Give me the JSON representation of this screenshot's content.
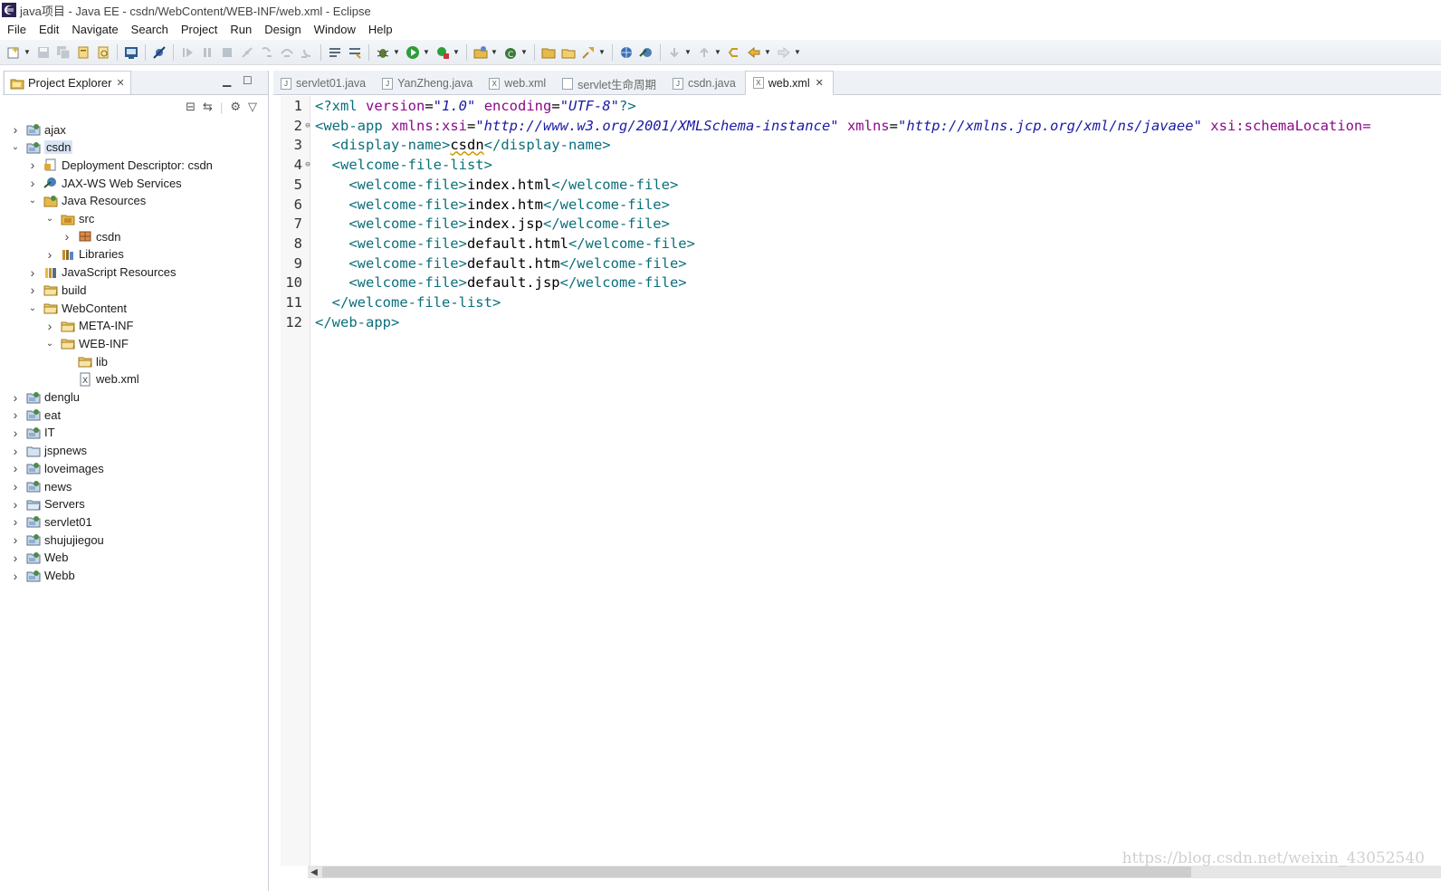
{
  "window": {
    "title": "java项目 - Java EE - csdn/WebContent/WEB-INF/web.xml - Eclipse"
  },
  "menu": [
    "File",
    "Edit",
    "Navigate",
    "Search",
    "Project",
    "Run",
    "Design",
    "Window",
    "Help"
  ],
  "explorer": {
    "tab_label": "Project Explorer",
    "tree": [
      {
        "label": "ajax",
        "depth": 0,
        "expanded": false,
        "icon": "project-icon"
      },
      {
        "label": "csdn",
        "depth": 0,
        "expanded": true,
        "icon": "project-icon",
        "selected": true
      },
      {
        "label": "Deployment Descriptor: csdn",
        "depth": 1,
        "expanded": false,
        "icon": "descriptor-icon"
      },
      {
        "label": "JAX-WS Web Services",
        "depth": 1,
        "expanded": false,
        "icon": "webservice-icon"
      },
      {
        "label": "Java Resources",
        "depth": 1,
        "expanded": true,
        "icon": "java-resources-icon"
      },
      {
        "label": "src",
        "depth": 2,
        "expanded": true,
        "icon": "src-folder-icon"
      },
      {
        "label": "csdn",
        "depth": 3,
        "expanded": false,
        "icon": "package-icon"
      },
      {
        "label": "Libraries",
        "depth": 2,
        "expanded": false,
        "icon": "library-icon"
      },
      {
        "label": "JavaScript Resources",
        "depth": 1,
        "expanded": false,
        "icon": "js-resources-icon"
      },
      {
        "label": "build",
        "depth": 1,
        "expanded": false,
        "icon": "folder-icon"
      },
      {
        "label": "WebContent",
        "depth": 1,
        "expanded": true,
        "icon": "folder-icon"
      },
      {
        "label": "META-INF",
        "depth": 2,
        "expanded": false,
        "icon": "folder-icon"
      },
      {
        "label": "WEB-INF",
        "depth": 2,
        "expanded": true,
        "icon": "folder-icon"
      },
      {
        "label": "lib",
        "depth": 3,
        "leaf": true,
        "icon": "folder-icon"
      },
      {
        "label": "web.xml",
        "depth": 3,
        "leaf": true,
        "icon": "xml-file-icon"
      },
      {
        "label": "denglu",
        "depth": 0,
        "expanded": false,
        "icon": "project-icon"
      },
      {
        "label": "eat",
        "depth": 0,
        "expanded": false,
        "icon": "project-icon"
      },
      {
        "label": "IT",
        "depth": 0,
        "expanded": false,
        "icon": "project-icon"
      },
      {
        "label": "jspnews",
        "depth": 0,
        "expanded": false,
        "icon": "plain-project-icon"
      },
      {
        "label": "loveimages",
        "depth": 0,
        "expanded": false,
        "icon": "project-icon"
      },
      {
        "label": "news",
        "depth": 0,
        "expanded": false,
        "icon": "project-icon"
      },
      {
        "label": "Servers",
        "depth": 0,
        "expanded": false,
        "icon": "servers-folder-icon"
      },
      {
        "label": "servlet01",
        "depth": 0,
        "expanded": false,
        "icon": "project-icon"
      },
      {
        "label": "shujujiegou",
        "depth": 0,
        "expanded": false,
        "icon": "project-icon"
      },
      {
        "label": "Web",
        "depth": 0,
        "expanded": false,
        "icon": "project-icon"
      },
      {
        "label": "Webb",
        "depth": 0,
        "expanded": false,
        "icon": "project-icon"
      }
    ]
  },
  "editor": {
    "tabs": [
      {
        "label": "servlet01.java",
        "icon": "J",
        "active": false
      },
      {
        "label": "YanZheng.java",
        "icon": "J",
        "active": false
      },
      {
        "label": "web.xml",
        "icon": "X",
        "active": false
      },
      {
        "label": "servlet生命周期",
        "icon": "",
        "active": false
      },
      {
        "label": "csdn.java",
        "icon": "J",
        "active": false
      },
      {
        "label": "web.xml",
        "icon": "X",
        "active": true
      }
    ],
    "lines": [
      {
        "n": "1",
        "fold": "",
        "tokens": [
          [
            "pi",
            "<?xml "
          ],
          [
            "attr",
            "version"
          ],
          [
            "txt",
            "="
          ],
          [
            "str",
            "\"1.0\""
          ],
          [
            "txt",
            " "
          ],
          [
            "attr",
            "encoding"
          ],
          [
            "txt",
            "="
          ],
          [
            "str",
            "\"UTF-8\""
          ],
          [
            "pi",
            "?>"
          ]
        ]
      },
      {
        "n": "2",
        "fold": "⊖",
        "tokens": [
          [
            "tag",
            "<web-app "
          ],
          [
            "attr",
            "xmlns:xsi"
          ],
          [
            "txt",
            "="
          ],
          [
            "str",
            "\"http://www.w3.org/2001/XMLSchema-instance\""
          ],
          [
            "txt",
            " "
          ],
          [
            "attr",
            "xmlns"
          ],
          [
            "txt",
            "="
          ],
          [
            "str",
            "\"http://xmlns.jcp.org/xml/ns/javaee\""
          ],
          [
            "txt",
            " "
          ],
          [
            "attr",
            "xsi:schemaLocation="
          ]
        ]
      },
      {
        "n": "3",
        "fold": "",
        "tokens": [
          [
            "txt",
            "  "
          ],
          [
            "tag",
            "<display-name>"
          ],
          [
            "sq",
            "csdn"
          ],
          [
            "tag",
            "</display-name>"
          ]
        ]
      },
      {
        "n": "4",
        "fold": "⊖",
        "tokens": [
          [
            "txt",
            "  "
          ],
          [
            "tag",
            "<welcome-file-list>"
          ]
        ]
      },
      {
        "n": "5",
        "fold": "",
        "tokens": [
          [
            "txt",
            "    "
          ],
          [
            "tag",
            "<welcome-file>"
          ],
          [
            "txt",
            "index.html"
          ],
          [
            "tag",
            "</welcome-file>"
          ]
        ]
      },
      {
        "n": "6",
        "fold": "",
        "tokens": [
          [
            "txt",
            "    "
          ],
          [
            "tag",
            "<welcome-file>"
          ],
          [
            "txt",
            "index.htm"
          ],
          [
            "tag",
            "</welcome-file>"
          ]
        ]
      },
      {
        "n": "7",
        "fold": "",
        "tokens": [
          [
            "txt",
            "    "
          ],
          [
            "tag",
            "<welcome-file>"
          ],
          [
            "txt",
            "index.jsp"
          ],
          [
            "tag",
            "</welcome-file>"
          ]
        ]
      },
      {
        "n": "8",
        "fold": "",
        "tokens": [
          [
            "txt",
            "    "
          ],
          [
            "tag",
            "<welcome-file>"
          ],
          [
            "txt",
            "default.html"
          ],
          [
            "tag",
            "</welcome-file>"
          ]
        ]
      },
      {
        "n": "9",
        "fold": "",
        "tokens": [
          [
            "txt",
            "    "
          ],
          [
            "tag",
            "<welcome-file>"
          ],
          [
            "txt",
            "default.htm"
          ],
          [
            "tag",
            "</welcome-file>"
          ]
        ]
      },
      {
        "n": "10",
        "fold": "",
        "tokens": [
          [
            "txt",
            "    "
          ],
          [
            "tag",
            "<welcome-file>"
          ],
          [
            "txt",
            "default.jsp"
          ],
          [
            "tag",
            "</welcome-file>"
          ]
        ]
      },
      {
        "n": "11",
        "fold": "",
        "tokens": [
          [
            "txt",
            "  "
          ],
          [
            "tag",
            "</welcome-file-list>"
          ]
        ]
      },
      {
        "n": "12",
        "fold": "",
        "tokens": [
          [
            "tag",
            "</web-app>"
          ]
        ]
      }
    ]
  },
  "watermark": "https://blog.csdn.net/weixin_43052540"
}
